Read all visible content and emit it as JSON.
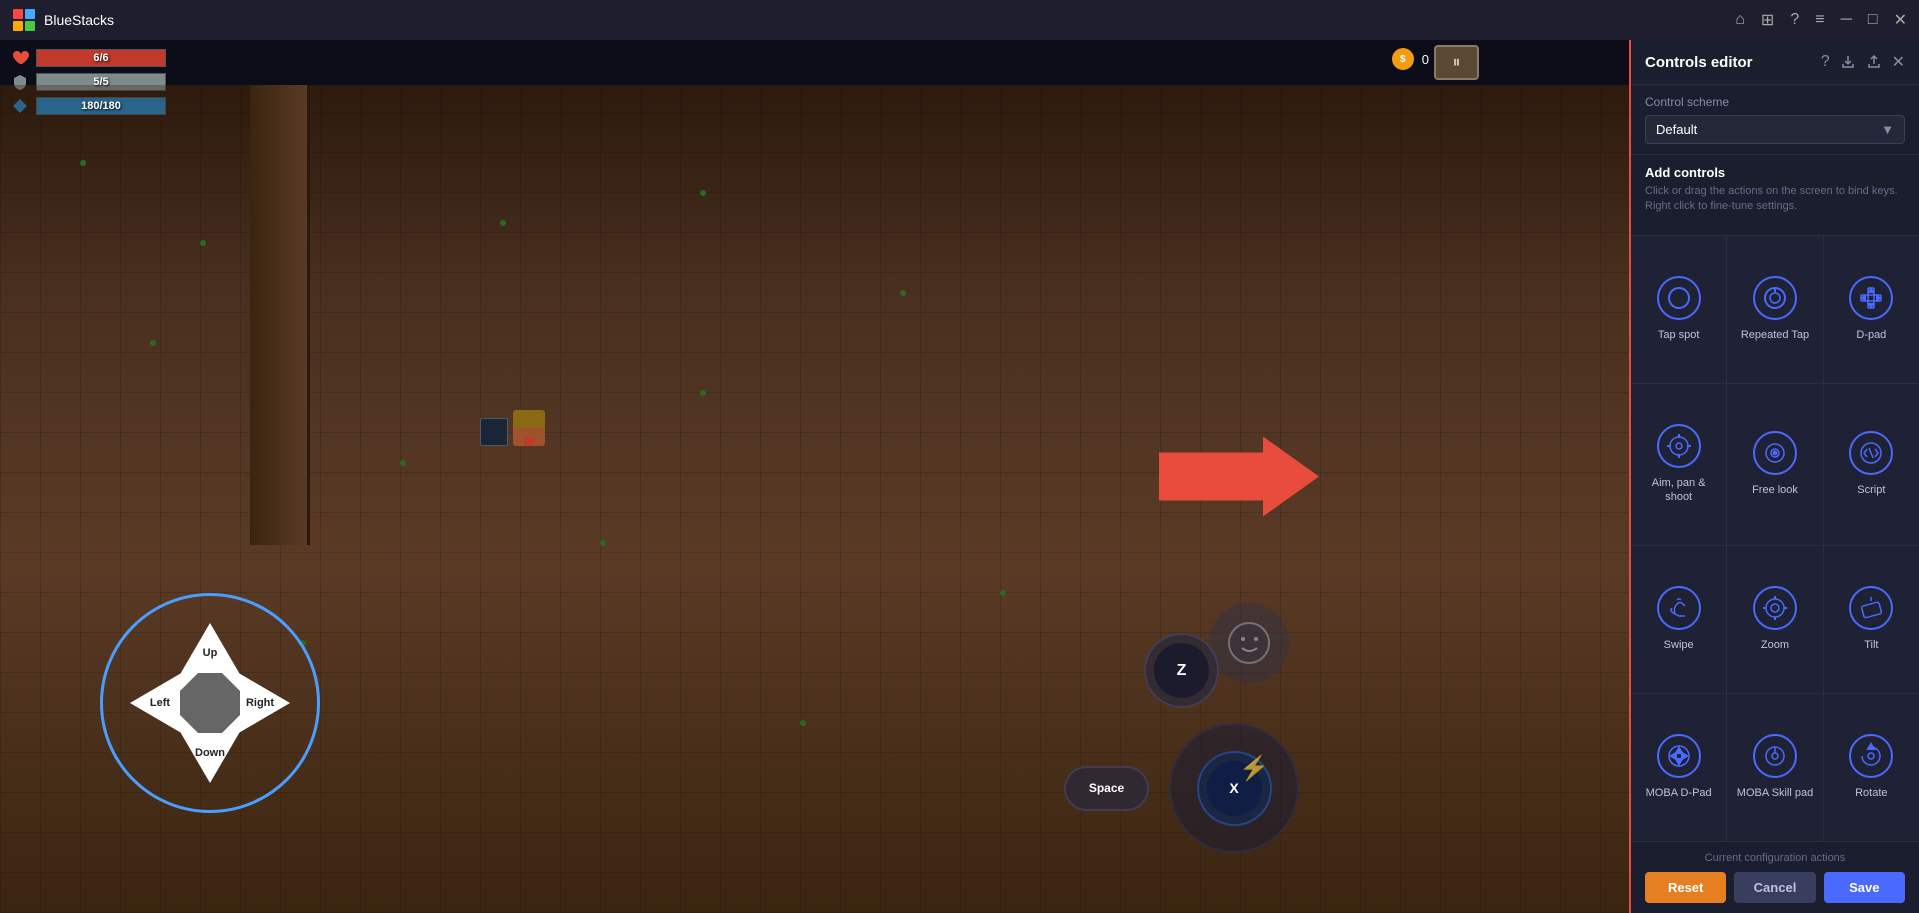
{
  "titleBar": {
    "appName": "BlueStacks",
    "icons": [
      "home",
      "grid",
      "question",
      "menu",
      "minimize",
      "maximize",
      "close"
    ]
  },
  "gameHUD": {
    "hp": "6/6",
    "mp": "5/5",
    "xp": "180/180",
    "coins": "0"
  },
  "dpad": {
    "up": "Up",
    "down": "Down",
    "left": "Left",
    "right": "Right"
  },
  "actionButtons": {
    "z": "Z",
    "space": "Space",
    "x": "X"
  },
  "panel": {
    "title": "Controls editor",
    "schemeLabel": "Control scheme",
    "schemeValue": "Default",
    "addControlsTitle": "Add controls",
    "addControlsDesc": "Click or drag the actions on the screen to bind keys. Right click to fine-tune settings.",
    "controls": [
      {
        "id": "tap-spot",
        "label": "Tap spot",
        "icon": "circle"
      },
      {
        "id": "repeated-tap",
        "label": "Repeated Tap",
        "icon": "repeated"
      },
      {
        "id": "d-pad",
        "label": "D-pad",
        "icon": "dpad"
      },
      {
        "id": "aim-pan-shoot",
        "label": "Aim, pan & shoot",
        "icon": "aim"
      },
      {
        "id": "free-look",
        "label": "Free look",
        "icon": "freelook"
      },
      {
        "id": "script",
        "label": "Script",
        "icon": "script"
      },
      {
        "id": "swipe",
        "label": "Swipe",
        "icon": "swipe"
      },
      {
        "id": "zoom",
        "label": "Zoom",
        "icon": "zoom"
      },
      {
        "id": "tilt",
        "label": "Tilt",
        "icon": "tilt"
      },
      {
        "id": "moba-dpad",
        "label": "MOBA D-Pad",
        "icon": "mobadpad"
      },
      {
        "id": "moba-skill-pad",
        "label": "MOBA Skill pad",
        "icon": "mobaskill"
      },
      {
        "id": "rotate",
        "label": "Rotate",
        "icon": "rotate"
      }
    ],
    "currentConfigLabel": "Current configuration actions",
    "resetLabel": "Reset",
    "cancelLabel": "Cancel",
    "saveLabel": "Save"
  },
  "colors": {
    "accent": "#4a6aff",
    "reset": "#e67e22",
    "panel_bg": "#1a1e2e",
    "border_red": "#e74c3c"
  }
}
